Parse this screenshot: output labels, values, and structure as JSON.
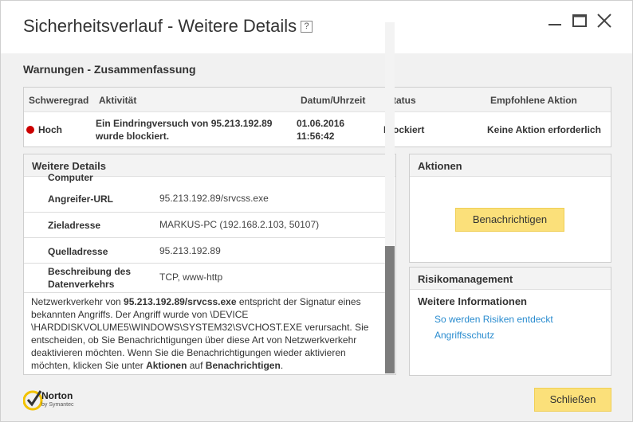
{
  "window": {
    "title": "Sicherheitsverlauf - Weitere Details",
    "help": "?"
  },
  "summary": {
    "section_title": "Warnungen - Zusammenfassung",
    "headers": {
      "severity": "Schweregrad",
      "activity": "Aktivität",
      "datetime": "Datum/Uhrzeit",
      "status": "Status",
      "action": "Empfohlene Aktion"
    },
    "row": {
      "severity": "Hoch",
      "severity_color": "#cc0000",
      "activity_line1": "Ein Eindringversuch von 95.213.192.89",
      "activity_line2": "wurde blockiert.",
      "date": "01.06.2016",
      "time": "11:56:42",
      "status": "Blockiert",
      "action": "Keine Aktion erforderlich"
    }
  },
  "details": {
    "header": "Weitere Details",
    "partial_label": "Computer",
    "rows": [
      {
        "label": "Angreifer-URL",
        "value": "95.213.192.89/srvcss.exe"
      },
      {
        "label": "Zieladresse",
        "value": "MARKUS-PC (192.168.2.103, 50107)"
      },
      {
        "label": "Quelladresse",
        "value": "95.213.192.89"
      },
      {
        "label_line1": "Beschreibung des",
        "label_line2": "Datenverkehrs",
        "value": "TCP, www-http"
      }
    ],
    "description": {
      "p1": "Netzwerkverkehr von ",
      "b1": "95.213.192.89/srvcss.exe",
      "p2": " entspricht der Signatur eines bekannten Angriffs. Der Angriff wurde von \\DEVICE \\HARDDISKVOLUME5\\WINDOWS\\SYSTEM32\\SVCHOST.EXE verursacht. Sie entscheiden, ob Sie Benachrichtigungen über diese Art von Netzwerkverkehr deaktivieren möchten. Wenn Sie die Benachrichtigungen wieder aktivieren möchten, klicken Sie unter ",
      "b2": "Aktionen",
      "p3": " auf ",
      "b3": "Benachrichtigen",
      "p4": "."
    }
  },
  "actions": {
    "header": "Aktionen",
    "notify_button": "Benachrichtigen"
  },
  "risk": {
    "header": "Risikomanagement",
    "subheader": "Weitere Informationen",
    "links": [
      "So werden Risiken entdeckt",
      "Angriffsschutz"
    ]
  },
  "footer": {
    "logo_text": "Norton",
    "logo_sub": "by Symantec",
    "close_button": "Schließen"
  },
  "colors": {
    "accent_yellow": "#fbe07a",
    "link_blue": "#2a8ccf",
    "severity_red": "#cc0000"
  }
}
